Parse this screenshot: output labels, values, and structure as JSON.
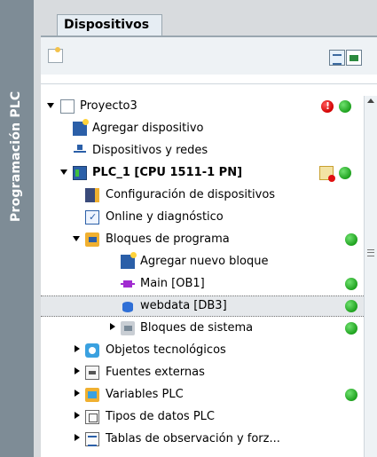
{
  "sidebar": {
    "title": "Programación PLC"
  },
  "tab": {
    "label": "Dispositivos"
  },
  "tree": {
    "items": [
      {
        "label": "Proyecto3",
        "icon": "project-icon",
        "status": [
          "error",
          "ok"
        ]
      },
      {
        "label": "Agregar dispositivo",
        "icon": "add-device-icon"
      },
      {
        "label": "Dispositivos y redes",
        "icon": "network-icon"
      },
      {
        "label": "PLC_1 [CPU 1511-1 PN]",
        "icon": "plc-icon",
        "status": [
          "warning",
          "ok"
        ]
      },
      {
        "label": "Configuración de dispositivos",
        "icon": "device-config-icon"
      },
      {
        "label": "Online y diagnóstico",
        "icon": "diagnostics-icon"
      },
      {
        "label": "Bloques de programa",
        "icon": "program-blocks-folder-icon",
        "status": [
          "ok"
        ]
      },
      {
        "label": "Agregar nuevo bloque",
        "icon": "add-block-icon"
      },
      {
        "label": "Main [OB1]",
        "icon": "ob-block-icon",
        "status": [
          "ok"
        ]
      },
      {
        "label": "webdata [DB3]",
        "icon": "db-block-icon",
        "status": [
          "ok"
        ],
        "selected": true
      },
      {
        "label": "Bloques de sistema",
        "icon": "system-blocks-folder-icon",
        "status": [
          "ok"
        ]
      },
      {
        "label": "Objetos tecnológicos",
        "icon": "tech-objects-icon"
      },
      {
        "label": "Fuentes externas",
        "icon": "external-sources-icon"
      },
      {
        "label": "Variables PLC",
        "icon": "plc-tags-icon",
        "status": [
          "ok"
        ]
      },
      {
        "label": "Tipos de datos PLC",
        "icon": "plc-data-types-icon"
      },
      {
        "label": "Tablas de observación y forz...",
        "icon": "watch-tables-icon"
      }
    ]
  },
  "colors": {
    "ok": "#1ea11e",
    "error": "#d10000",
    "selection": "#e5e8eb",
    "sidebar": "#7e8c96"
  }
}
